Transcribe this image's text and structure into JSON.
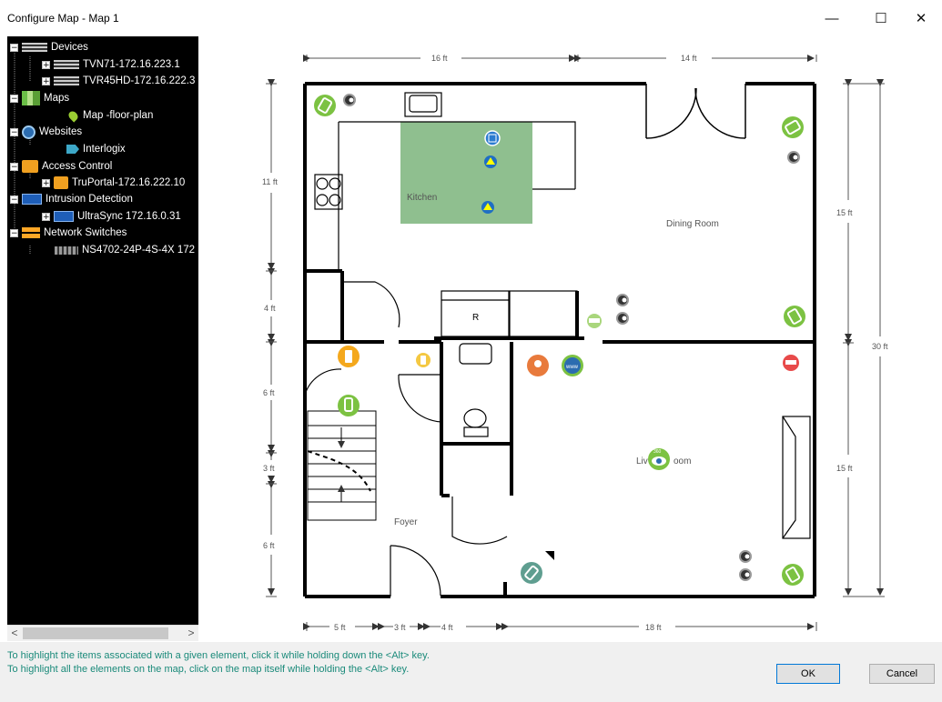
{
  "window": {
    "title": "Configure Map - Map 1",
    "minimize": "—",
    "maximize": "☐",
    "close": "✕"
  },
  "tree": [
    {
      "label": "Devices",
      "level": 0,
      "expander": "−",
      "icon": "devices-icon"
    },
    {
      "label": "TVN71-172.16.223.1",
      "level": 1,
      "expander": "+",
      "icon": "recorder-icon"
    },
    {
      "label": "TVR45HD-172.16.222.3",
      "level": 1,
      "expander": "+",
      "icon": "recorder-icon"
    },
    {
      "label": "Maps",
      "level": 0,
      "expander": "−",
      "icon": "maps-icon"
    },
    {
      "label": "Map -floor-plan",
      "level": 2,
      "expander": "",
      "icon": "map-pin-icon"
    },
    {
      "label": "Websites",
      "level": 0,
      "expander": "−",
      "icon": "globe-icon"
    },
    {
      "label": "Interlogix",
      "level": 2,
      "expander": "",
      "icon": "tag-icon"
    },
    {
      "label": "Access Control",
      "level": 0,
      "expander": "−",
      "icon": "lock-icon"
    },
    {
      "label": "TruPortal-172.16.222.10",
      "level": 1,
      "expander": "+",
      "icon": "access-panel-icon"
    },
    {
      "label": "Intrusion Detection",
      "level": 0,
      "expander": "−",
      "icon": "intrusion-icon"
    },
    {
      "label": "UltraSync 172.16.0.31",
      "level": 1,
      "expander": "+",
      "icon": "keypad-icon"
    },
    {
      "label": "Network Switches",
      "level": 0,
      "expander": "−",
      "icon": "network-icon"
    },
    {
      "label": "NS4702-24P-4S-4X 172",
      "level": 2,
      "expander": "",
      "icon": "switch-icon"
    }
  ],
  "scroll": {
    "left": "<",
    "right": ">"
  },
  "map": {
    "rooms": {
      "kitchen": "Kitchen",
      "dining": "Dining Room",
      "living_left": "Liv",
      "living_right": "oom",
      "foyer": "Foyer",
      "r": "R"
    },
    "dims": {
      "top1": "16 ft",
      "top2": "14 ft",
      "left1": "11 ft",
      "left2": "4 ft",
      "left3": "6 ft",
      "left4": "3 ft",
      "left5": "6 ft",
      "right1": "15 ft",
      "right2": "15 ft",
      "right_total": "30 ft",
      "bottom1": "5 ft",
      "bottom2": "3 ft",
      "bottom3": "4 ft",
      "bottom4": "18 ft"
    },
    "badge_www": "www",
    "badge_360": "360"
  },
  "footer": {
    "hint1": "To highlight the items associated with a given element, click it while holding down the <Alt> key.",
    "hint2": "To highlight all the elements on the map, click on the map itself while holding the <Alt> key.",
    "ok": "OK",
    "cancel": "Cancel"
  },
  "colors": {
    "green": "#7cc242",
    "orange": "#f4a81d",
    "accent": "#0078d7",
    "hint": "#1a8a7a"
  }
}
